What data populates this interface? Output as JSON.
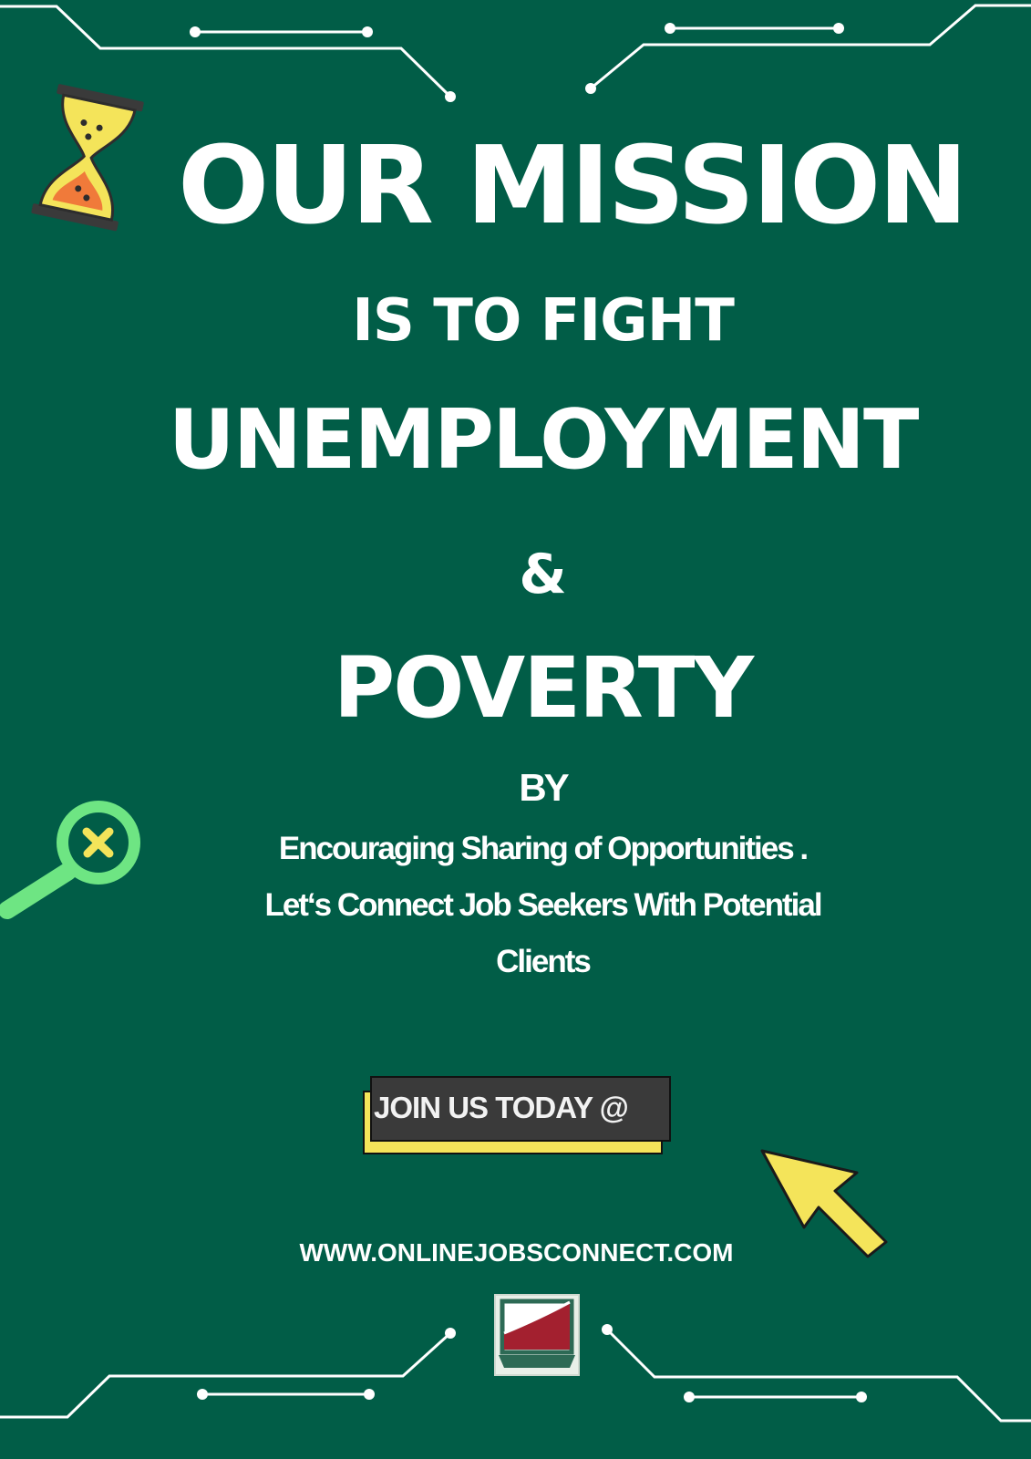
{
  "poster": {
    "title": "OUR MISSION",
    "line_2": "IS TO FIGHT",
    "line_3": "UNEMPLOYMENT",
    "line_4": "&",
    "line_5": "POVERTY",
    "line_6": "BY",
    "body_lines": [
      "Encouraging Sharing of  Opportunities .",
      "Let‘s  Connect  Job Seekers With Potential",
      "Clients"
    ],
    "join_button_label": "JOIN US TODAY @",
    "website_url": "WWW.ONLINEJOBSCONNECT.COM"
  },
  "colors": {
    "background": "#015d47",
    "text": "#ffffff",
    "accent_yellow": "#f4e45a",
    "accent_green": "#6ee583",
    "button_dark": "#3a3a3a",
    "accent_orange": "#f07a3a",
    "logo_red": "#a3202f"
  },
  "icons": [
    "hourglass-icon",
    "magnifier-icon",
    "cursor-arrow-icon",
    "logo-icon",
    "circuit-lines"
  ]
}
